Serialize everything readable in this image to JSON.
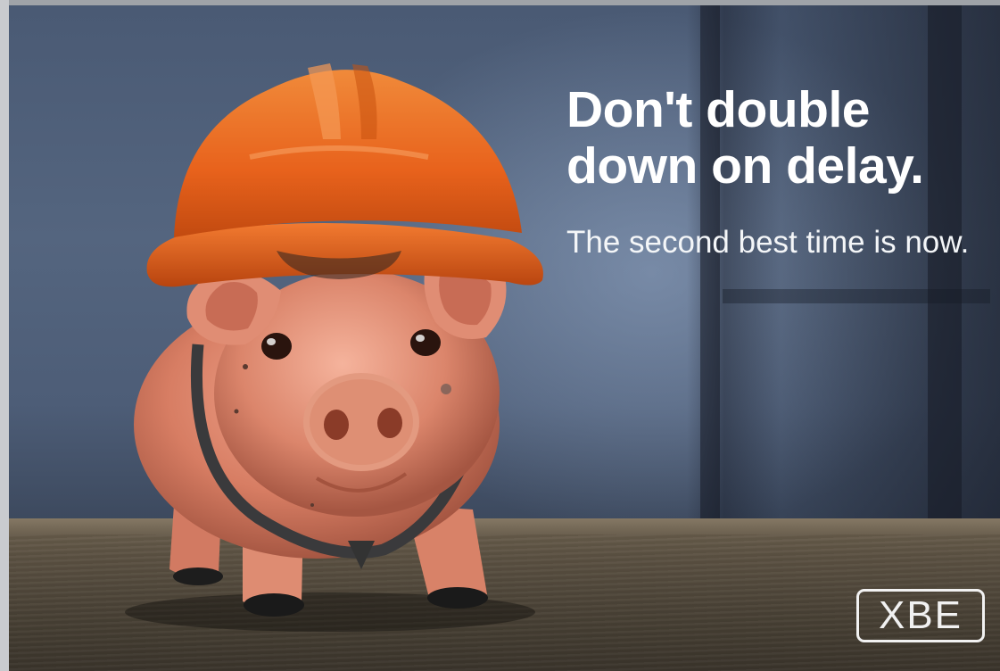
{
  "headline": {
    "line1": "Don't double",
    "line2": "down on delay."
  },
  "subheadline": "The second best time is now.",
  "logo": {
    "text": "XBE"
  },
  "colors": {
    "hardhat": "#e8621c",
    "pig": "#d9806a",
    "text": "#ffffff"
  }
}
